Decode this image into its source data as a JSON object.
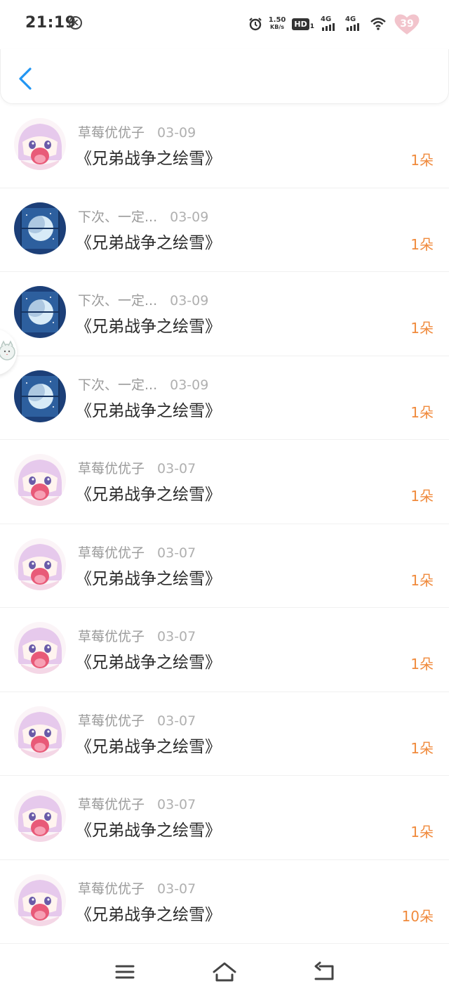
{
  "status_bar": {
    "time": "21:19",
    "k_badge": "K",
    "speed_value": "1.50",
    "speed_unit": "KB/s",
    "hd_label": "HD",
    "hd_sub": "1",
    "signal1_label": "4G",
    "signal2_label": "4G",
    "battery_level": "39",
    "icons": [
      "alarm-icon",
      "wifi-icon",
      "battery-heart-icon"
    ]
  },
  "header": {
    "back_icon": "chevron-left-icon",
    "accent_color": "#2196f3"
  },
  "list": {
    "count_color": "#f08a3c",
    "items": [
      {
        "avatar": "anime-girl",
        "name": "草莓优优子",
        "date": "03-09",
        "title": "《兄弟战争之绘雪》",
        "count": "1朵"
      },
      {
        "avatar": "moon",
        "name": "下次、一定...",
        "date": "03-09",
        "title": "《兄弟战争之绘雪》",
        "count": "1朵"
      },
      {
        "avatar": "moon",
        "name": "下次、一定...",
        "date": "03-09",
        "title": "《兄弟战争之绘雪》",
        "count": "1朵"
      },
      {
        "avatar": "moon",
        "name": "下次、一定...",
        "date": "03-09",
        "title": "《兄弟战争之绘雪》",
        "count": "1朵"
      },
      {
        "avatar": "anime-girl",
        "name": "草莓优优子",
        "date": "03-07",
        "title": "《兄弟战争之绘雪》",
        "count": "1朵"
      },
      {
        "avatar": "anime-girl",
        "name": "草莓优优子",
        "date": "03-07",
        "title": "《兄弟战争之绘雪》",
        "count": "1朵"
      },
      {
        "avatar": "anime-girl",
        "name": "草莓优优子",
        "date": "03-07",
        "title": "《兄弟战争之绘雪》",
        "count": "1朵"
      },
      {
        "avatar": "anime-girl",
        "name": "草莓优优子",
        "date": "03-07",
        "title": "《兄弟战争之绘雪》",
        "count": "1朵"
      },
      {
        "avatar": "anime-girl",
        "name": "草莓优优子",
        "date": "03-07",
        "title": "《兄弟战争之绘雪》",
        "count": "1朵"
      },
      {
        "avatar": "anime-girl",
        "name": "草莓优优子",
        "date": "03-07",
        "title": "《兄弟战争之绘雪》",
        "count": "10朵"
      }
    ]
  },
  "navbar": {
    "icons": [
      "menu-icon",
      "home-icon",
      "back-icon"
    ]
  }
}
